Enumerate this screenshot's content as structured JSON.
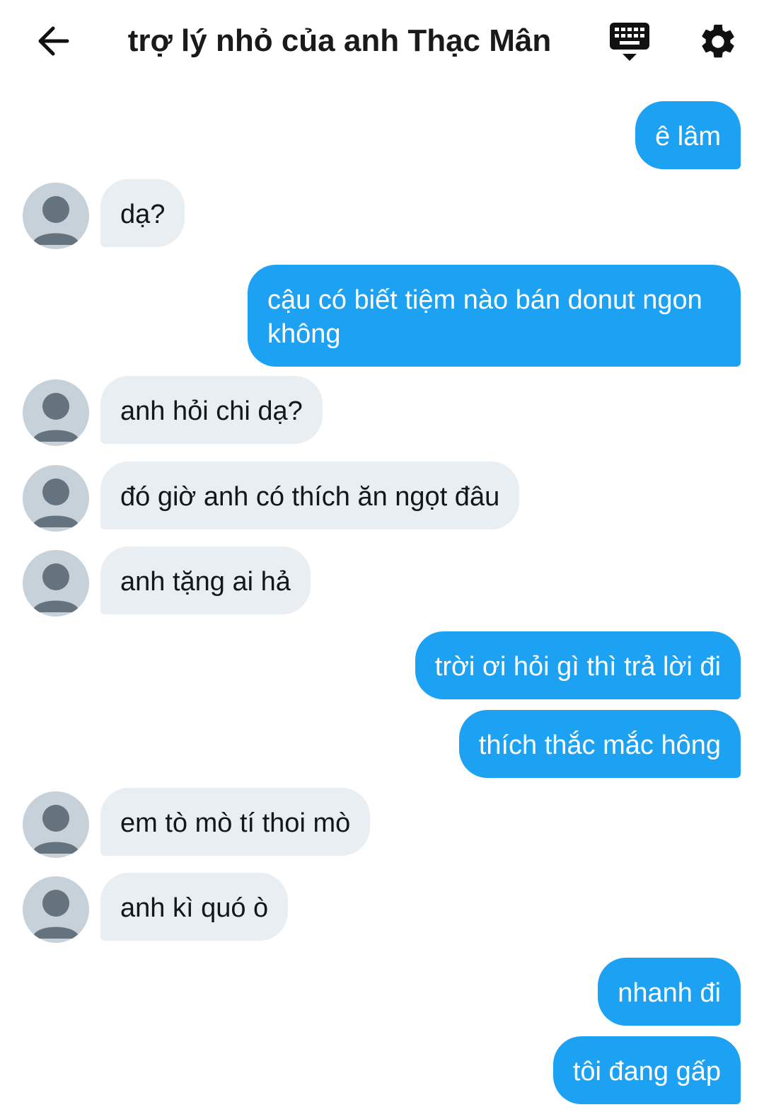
{
  "header": {
    "title": "trợ lý nhỏ của anh Thạc Mân",
    "back_icon": "arrow-left-icon",
    "keyboard_icon": "keyboard-icon",
    "settings_icon": "gear-icon"
  },
  "colors": {
    "outgoing_bubble": "#1da1f2",
    "incoming_bubble": "#e9eef3",
    "avatar_bg": "#c7d1d9",
    "avatar_fg": "#65737f"
  },
  "messages": [
    {
      "direction": "out",
      "text": "ê lâm"
    },
    {
      "direction": "in",
      "text": "dạ?"
    },
    {
      "direction": "out",
      "text": "cậu có biết tiệm nào bán donut ngon không"
    },
    {
      "direction": "in",
      "text": "anh hỏi chi dạ?"
    },
    {
      "direction": "in",
      "text": "đó giờ anh có thích ăn ngọt đâu"
    },
    {
      "direction": "in",
      "text": "anh tặng ai hả"
    },
    {
      "direction": "out",
      "text": "trời ơi hỏi gì thì trả lời đi"
    },
    {
      "direction": "out",
      "text": "thích thắc mắc hông"
    },
    {
      "direction": "in",
      "text": "em tò mò tí thoi mò"
    },
    {
      "direction": "in",
      "text": "anh kì quó ò"
    },
    {
      "direction": "out",
      "text": "nhanh đi"
    },
    {
      "direction": "out",
      "text": "tôi đang gấp"
    }
  ]
}
